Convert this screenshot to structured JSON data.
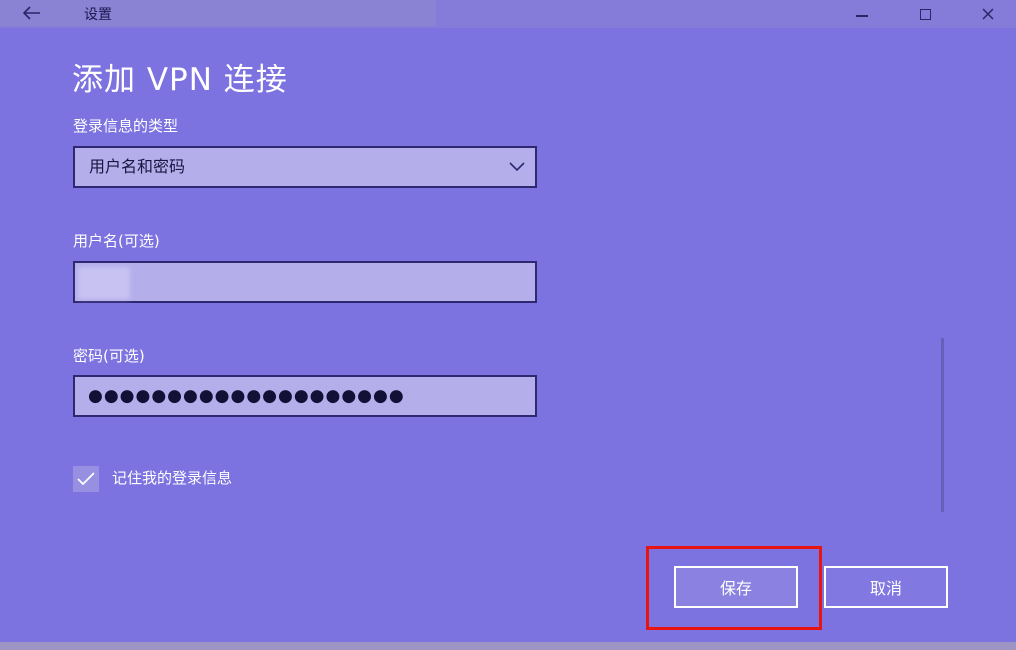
{
  "window": {
    "app_title": "设置",
    "back_icon": "back-arrow-icon",
    "minimize_icon": "minimize-icon",
    "maximize_icon": "maximize-icon",
    "close_icon": "close-icon"
  },
  "page": {
    "title": "添加 VPN 连接"
  },
  "form": {
    "signin_type": {
      "label": "登录信息的类型",
      "selected": "用户名和密码",
      "icon": "chevron-down-icon"
    },
    "username": {
      "label": "用户名(可选)",
      "value": ""
    },
    "password": {
      "label": "密码(可选)",
      "masked_value": "●●●●●●●●●●●●●●●●●●●●"
    },
    "remember": {
      "label": "记住我的登录信息",
      "checked": true,
      "icon": "checkmark-icon"
    }
  },
  "actions": {
    "save_label": "保存",
    "cancel_label": "取消"
  },
  "colors": {
    "background": "#7c72e0",
    "highlight": "#e8140f",
    "input_bg": "#b4aeeb",
    "input_border": "#2d2870"
  }
}
